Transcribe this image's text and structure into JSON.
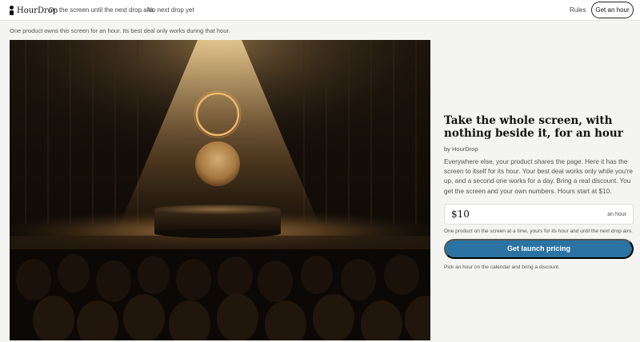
{
  "header": {
    "logo_text": "HourDrop",
    "status_now": "On the screen until the next drop airs",
    "status_next": "No next drop yet",
    "rules_label": "Rules",
    "cta_label": "Get an hour"
  },
  "notice": "One product owns this screen for an hour. Its best deal only works during that hour.",
  "hero_image_alt": "Spotlit stage with glowing rings above a round pedestal and an audience",
  "panel": {
    "title": "Take the whole screen, with nothing beside it, for an hour",
    "byline": "by HourDrop",
    "description": "Everywhere else, your product shares the page. Here it has the screen to itself for its hour. Your best deal works only while you're up, and a second one works for a day. Bring a real discount. You get the screen and your own numbers. Hours start at $10.",
    "price_value": "$10",
    "price_unit": "an hour",
    "price_note": "One product on the screen at a time, yours for its hour and until the next drop airs.",
    "cta_label": "Get launch pricing",
    "cta_note": "Pick an hour on the calendar and bring a discount."
  },
  "colors": {
    "accent": "#2a73a2",
    "background": "#f4f4f2"
  }
}
